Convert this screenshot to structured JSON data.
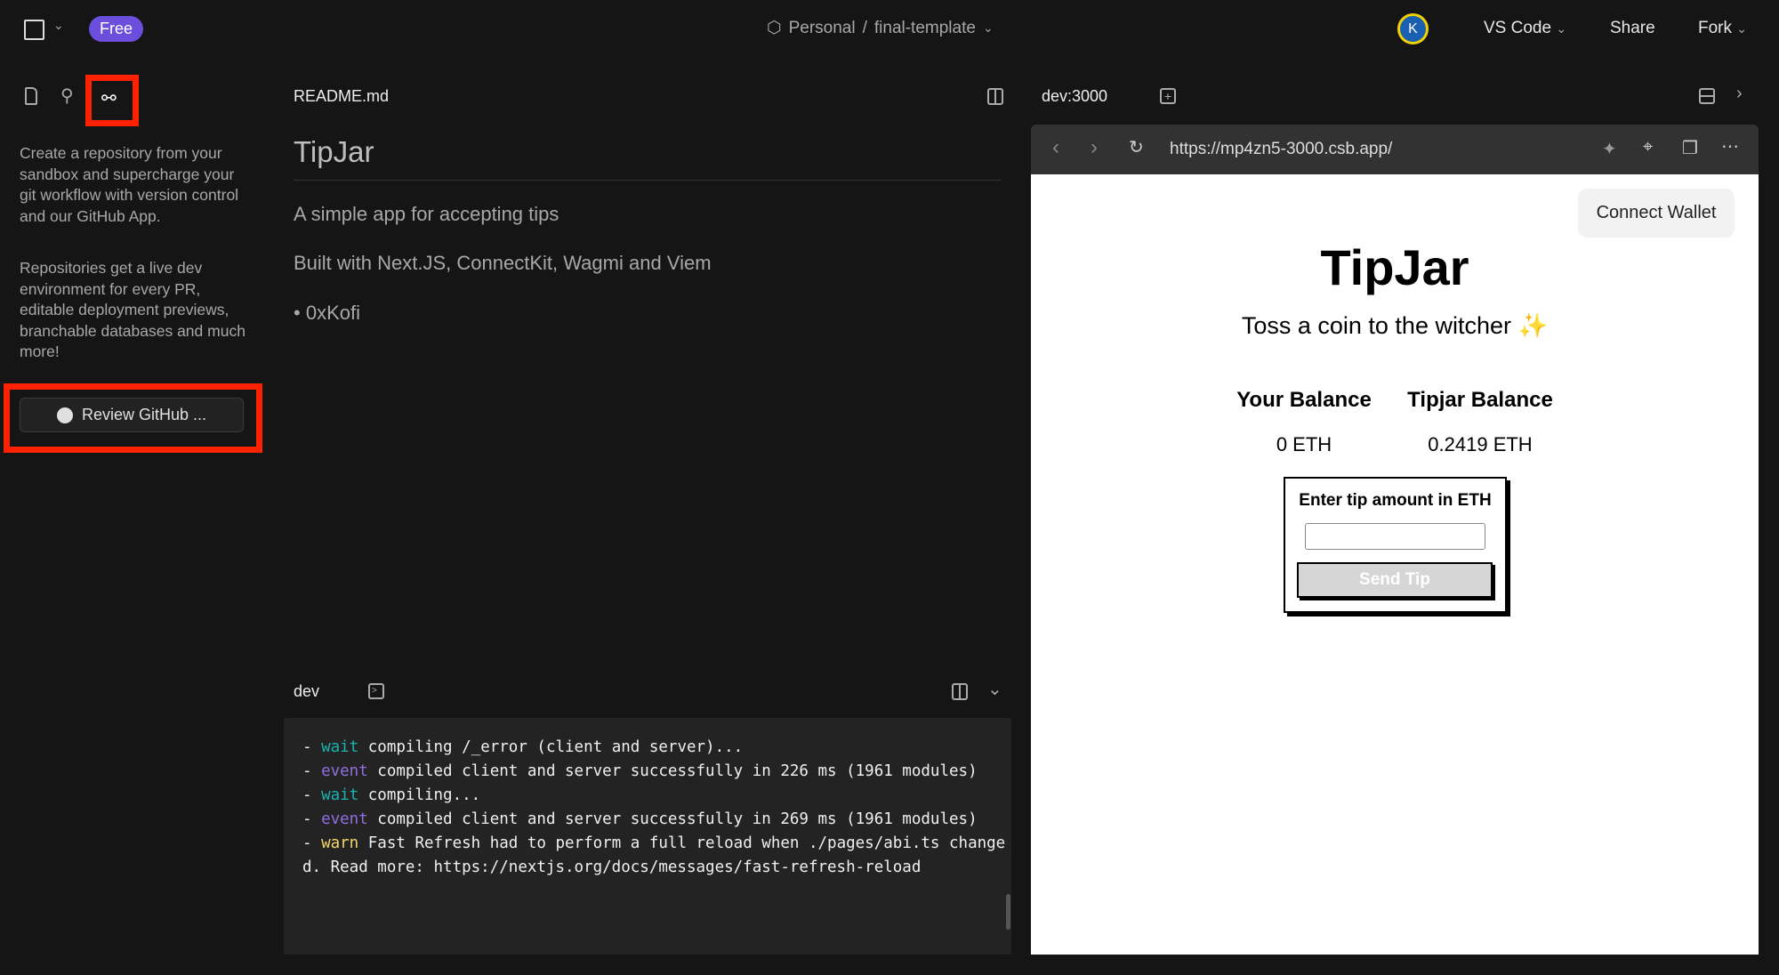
{
  "topbar": {
    "plan_badge": "Free",
    "workspace": "Personal",
    "separator": "/",
    "project": "final-template",
    "avatar_initial": "K",
    "editor_menu": "VS Code",
    "share": "Share",
    "fork": "Fork"
  },
  "sidebar": {
    "description1": "Create a repository from your sandbox and supercharge your git workflow with version control and our GitHub App.",
    "description2": "Repositories get a live dev environment for every PR, editable deployment previews, branchable databases and much more!",
    "review_button": "Review GitHub ..."
  },
  "editor": {
    "tab": "README.md",
    "title": "TipJar",
    "line1": "A simple app for accepting tips",
    "line2": "Built with Next.JS, ConnectKit, Wagmi and Viem",
    "bullet": "0xKofi"
  },
  "terminal": {
    "tab": "dev",
    "lines": [
      {
        "dash": "- ",
        "tag": "wait",
        "text": " compiling /_error (client and server)..."
      },
      {
        "dash": "- ",
        "tag": "event",
        "text": " compiled client and server successfully in 226 ms (1961 modules)"
      },
      {
        "dash": "- ",
        "tag": "wait",
        "text": " compiling..."
      },
      {
        "dash": "- ",
        "tag": "event",
        "text": " compiled client and server successfully in 269 ms (1961 modules)"
      },
      {
        "dash": "- ",
        "tag": "warn",
        "text": " Fast Refresh had to perform a full reload when ./pages/abi.ts change"
      },
      {
        "dash": "",
        "tag": "",
        "text": "d. Read more: https://nextjs.org/docs/messages/fast-refresh-reload"
      }
    ]
  },
  "preview": {
    "tab": "dev:3000",
    "url": "https://mp4zn5-3000.csb.app/",
    "connect_wallet": "Connect Wallet",
    "title": "TipJar",
    "subtitle": "Toss a coin to the witcher",
    "sparkle": "✨",
    "your_balance_label": "Your Balance",
    "your_balance": "0 ETH",
    "tipjar_balance_label": "Tipjar Balance",
    "tipjar_balance": "0.2419 ETH",
    "tip_label": "Enter tip amount in ETH",
    "tip_input": "",
    "send_button": "Send Tip"
  },
  "colors": {
    "accent": "#6b4fdc",
    "highlight": "#ff2200"
  }
}
